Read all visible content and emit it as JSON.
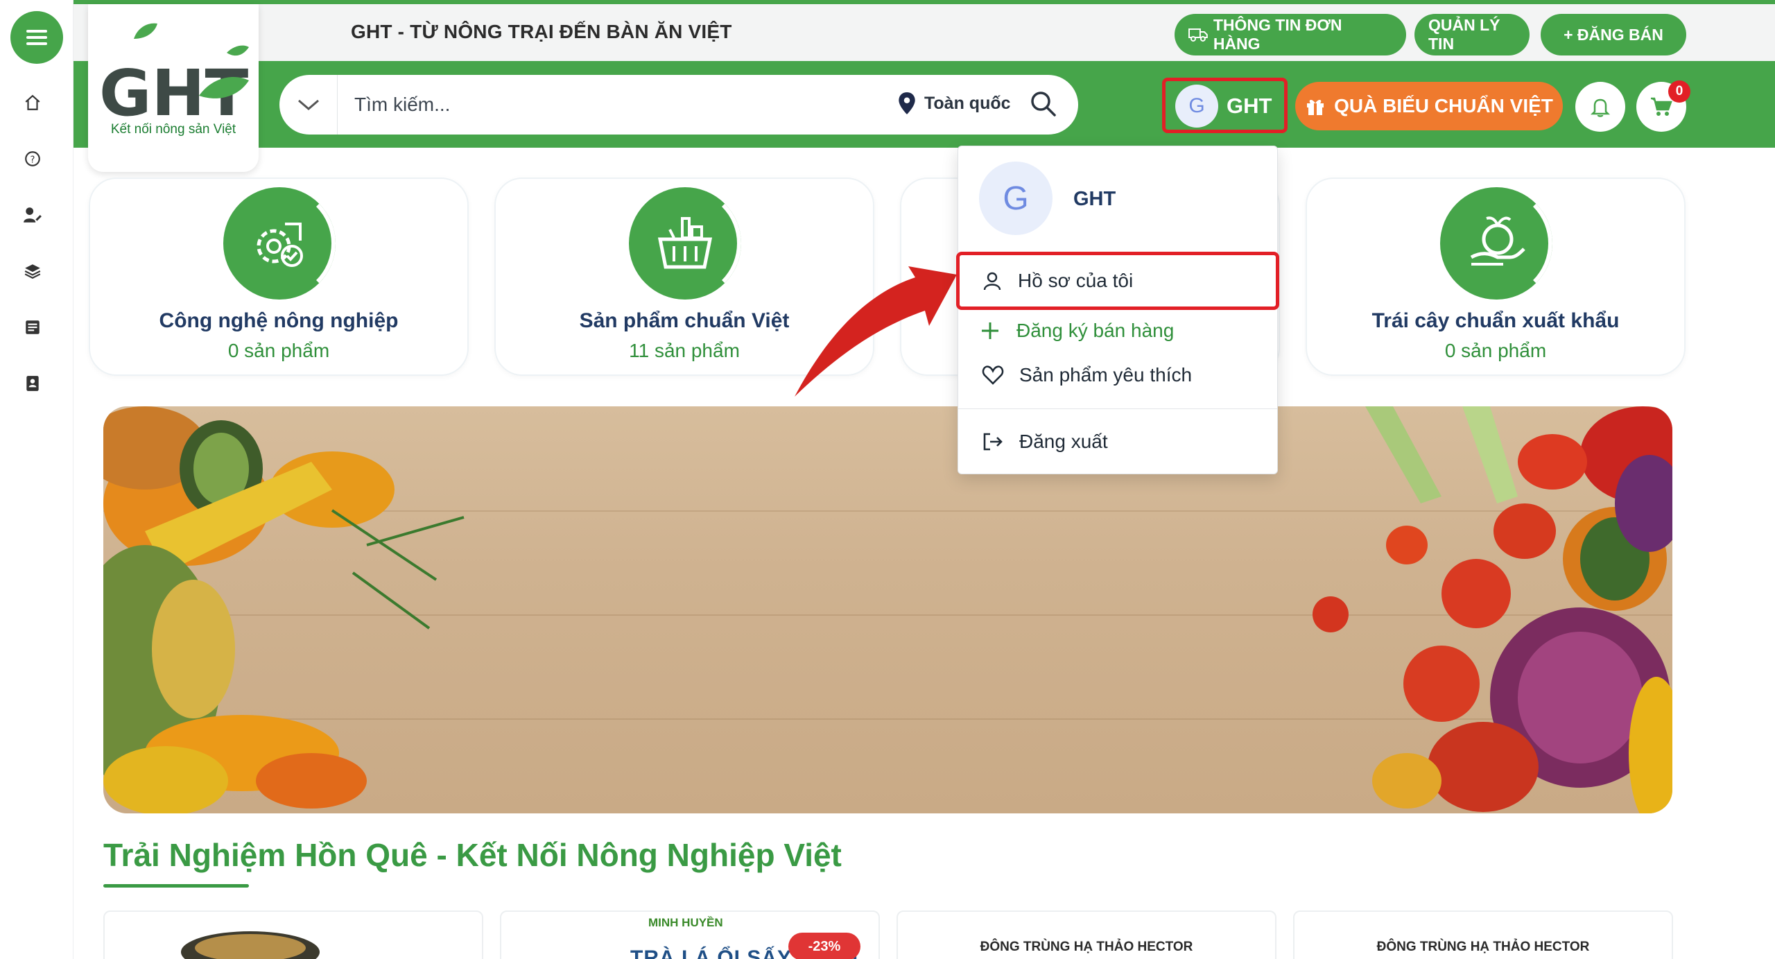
{
  "header": {
    "slogan": "GHT - TỪ NÔNG TRẠI ĐẾN BÀN ĂN VIỆT",
    "order_info_label": "THÔNG TIN ĐƠN HÀNG",
    "manage_label": "QUẢN LÝ TIN",
    "post_label": "+ ĐĂNG BÁN"
  },
  "logo": {
    "text": "GHT",
    "tagline": "Kết nối nông sản Việt"
  },
  "search": {
    "placeholder": "Tìm kiếm...",
    "location": "Toàn quốc"
  },
  "user": {
    "initial": "G",
    "name": "GHT"
  },
  "gift_button": "QUÀ BIẾU CHUẨN VIỆT",
  "cart_count": "0",
  "categories": [
    {
      "title": "Công nghệ nông nghiệp",
      "count": "0 sản phẩm"
    },
    {
      "title": "Sản phẩm chuẩn Việt",
      "count": "11 sản phẩm"
    },
    {
      "title": "",
      "count": ""
    },
    {
      "title": "Trái cây chuẩn xuất khẩu",
      "count": "0 sản phẩm"
    }
  ],
  "dropdown": {
    "initial": "G",
    "name": "GHT",
    "items": [
      {
        "label": "Hồ sơ của tôi"
      },
      {
        "label": "Đăng ký bán hàng"
      },
      {
        "label": "Sản phẩm yêu thích"
      },
      {
        "label": "Đăng xuất"
      }
    ]
  },
  "section": {
    "title": "Trải Nghiệm Hồn Quê - Kết Nối Nông Nghiệp Việt"
  },
  "products": [
    {
      "brand": "",
      "name": "",
      "discount": ""
    },
    {
      "brand": "MINH HUYỀN",
      "name": "TRÀ LÁ ỔI SẤY LẠNH",
      "discount": "-23%"
    },
    {
      "brand": "",
      "name": "ĐÔNG TRÙNG HẠ THẢO HECTOR",
      "discount": ""
    },
    {
      "brand": "",
      "name": "ĐÔNG TRÙNG HẠ THẢO HECTOR",
      "discount": ""
    }
  ],
  "colors": {
    "brand_green": "#46a54a",
    "accent_orange": "#ef7a2e",
    "highlight_red": "#e21f26"
  }
}
